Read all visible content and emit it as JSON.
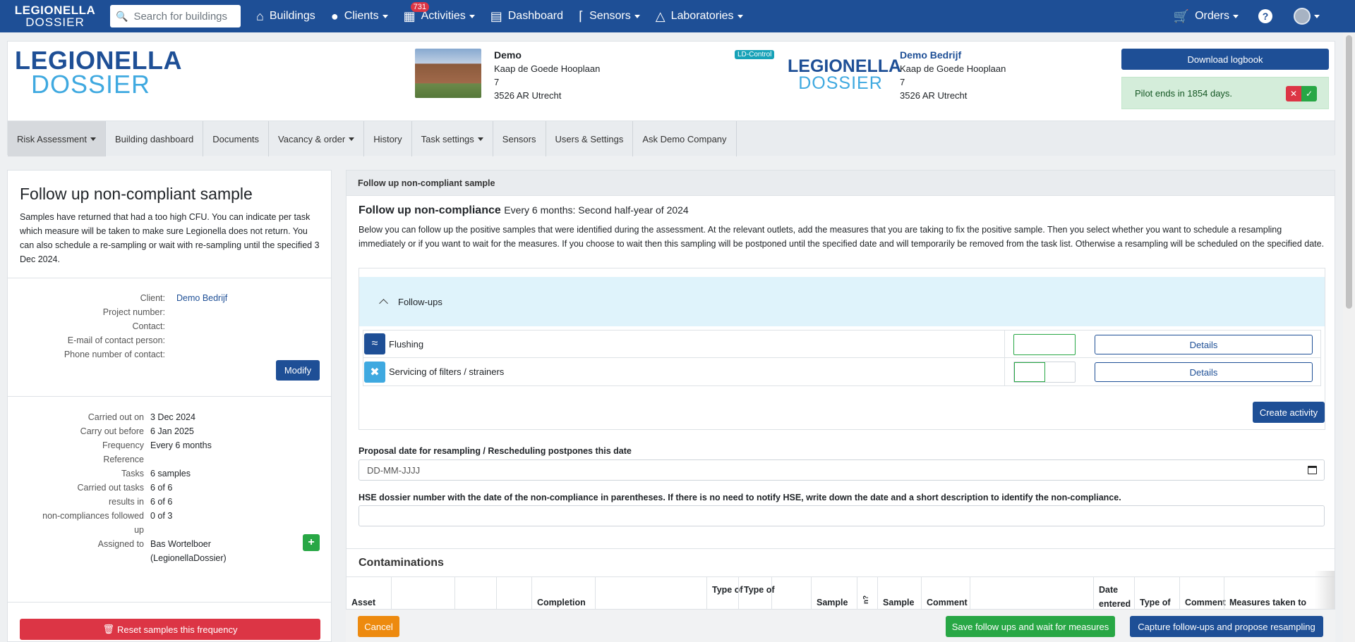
{
  "nav": {
    "logo_top": "LEGIONELLA",
    "logo_bottom": "DOSSIER",
    "search_placeholder": "Search for buildings",
    "items": [
      {
        "label": "Buildings",
        "icon": "house-icon"
      },
      {
        "label": "Clients",
        "icon": "user-icon"
      },
      {
        "label": "Activities",
        "icon": "calendar-icon",
        "badge": "731"
      },
      {
        "label": "Dashboard",
        "icon": "bar-chart-icon"
      },
      {
        "label": "Sensors",
        "icon": "thermometer-icon"
      },
      {
        "label": "Laboratories",
        "icon": "flask-icon"
      }
    ],
    "orders_label": "Orders",
    "help": "?"
  },
  "header": {
    "logo_top": "LEGIONELLA",
    "logo_bottom": "DOSSIER",
    "building": {
      "name": "Demo",
      "street": "Kaap de Goede Hooplaan",
      "number": "7",
      "city": "3526 AR Utrecht"
    },
    "company_badge": "LD-Control",
    "company": {
      "name": "Demo Bedrijf",
      "street": "Kaap de Goede Hooplaan",
      "number": "7",
      "city": "3526 AR Utrecht"
    },
    "download_label": "Download logbook",
    "pilot_text": "Pilot ends in 1854 days."
  },
  "tabs": [
    {
      "label": "Risk Assessment",
      "dropdown": true
    },
    {
      "label": "Building dashboard",
      "dropdown": false
    },
    {
      "label": "Documents",
      "dropdown": false
    },
    {
      "label": "Vacancy & order",
      "dropdown": true
    },
    {
      "label": "History",
      "dropdown": false
    },
    {
      "label": "Task settings",
      "dropdown": true
    },
    {
      "label": "Sensors",
      "dropdown": false
    },
    {
      "label": "Users & Settings",
      "dropdown": false
    },
    {
      "label": "Ask Demo Company",
      "dropdown": false
    }
  ],
  "left": {
    "title": "Follow up non-compliant sample",
    "intro": "Samples have returned that had a too high CFU. You can indicate per task which measure will be taken to make sure Legionella does not return. You can also schedule a re-sampling or wait with re-sampling until the specified 3 Dec 2024.",
    "client_label": "Client:",
    "client_value": "Demo Bedrijf",
    "project_label": "Project number:",
    "contact_label": "Contact:",
    "email_label": "E-mail of contact person:",
    "phone_label": "Phone number of contact:",
    "modify_label": "Modify",
    "carried_out_on_label": "Carried out on",
    "carried_out_on_value": "3 Dec 2024",
    "carry_before_label": "Carry out before",
    "carry_before_value": "6 Jan 2025",
    "frequency_label": "Frequency",
    "frequency_value": "Every 6 months",
    "reference_label": "Reference",
    "tasks_label": "Tasks",
    "tasks_value": "6 samples",
    "carried_tasks_label": "Carried out tasks",
    "carried_tasks_value": "6 of 6",
    "results_label": "results in",
    "results_value": "6 of 6",
    "noncomp_label_1": "non-compliances followed",
    "noncomp_label_2": "up",
    "noncomp_value": "0 of 3",
    "assigned_label": "Assigned to",
    "assigned_value_1": "Bas Wortelboer",
    "assigned_value_2": "(LegionellaDossier)",
    "reset_label": "Reset samples this frequency"
  },
  "main": {
    "panel_title": "Follow up non-compliant sample",
    "fu_title": "Follow up non-compliance",
    "fu_sub": "Every 6 months: Second half-year of 2024",
    "fu_desc": "Below you can follow up the positive samples that were identified during the assessment. At the relevant outlets, add the measures that you are taking to fix the positive sample. Then you select whether you want to schedule a resampling immediately or if you want to wait for the measures. If you choose to wait then this sampling will be postponed until the specified date and will temporarily be removed from the task list. Otherwise a resampling will be scheduled on the specified date.",
    "followups_label": "Follow-ups",
    "followups": [
      {
        "label": "Flushing",
        "icon": "water-flow-icon",
        "color": "#1e4f96",
        "details": "Details"
      },
      {
        "label": "Servicing of filters / strainers",
        "icon": "tools-icon",
        "color": "#3fa9e0",
        "details": "Details"
      }
    ],
    "create_activity_label": "Create activity",
    "proposal_label": "Proposal date for resampling / Rescheduling postpones this date",
    "proposal_placeholder": "DD-MM-JJJJ",
    "hse_label": "HSE dossier number with the date of the non-compliance in parentheses. If there is no need to notify HSE, write down the date and a short description to identify the non-compliance.",
    "hse_value": "",
    "contaminations_title": "Contaminations",
    "columns": {
      "asset": "Asset",
      "completion": "Completion",
      "type_of_1": "Type of",
      "type_of_2": "Type of",
      "sample": "Sample",
      "rotated": "n?",
      "sample_2": "Sample",
      "comment": "Comment",
      "date_entered": "Date entered",
      "type_of_3": "Type of",
      "comment_2": "Comment",
      "measures": "Measures taken to"
    }
  },
  "bottom": {
    "cancel": "Cancel",
    "save_wait": "Save follow ups and wait for measures",
    "capture": "Capture follow-ups and propose resampling"
  },
  "colors": {
    "primary": "#1e4f96",
    "accent": "#3fa9e0",
    "danger": "#dc3545",
    "success": "#28a745",
    "warning": "#ed8a0f"
  }
}
